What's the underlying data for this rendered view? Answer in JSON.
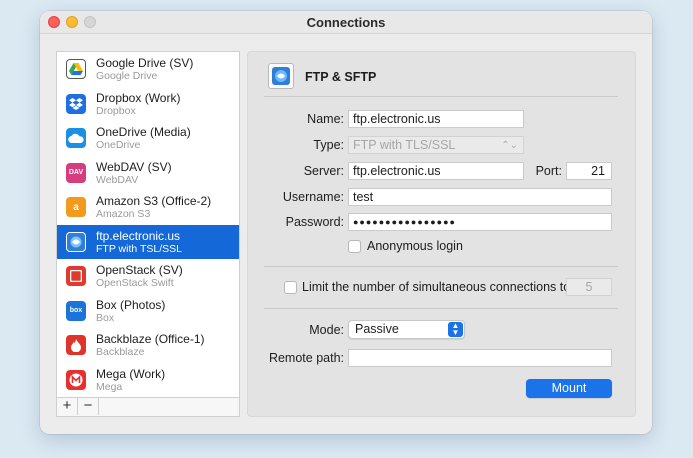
{
  "window": {
    "title": "Connections"
  },
  "sidebar": {
    "items": [
      {
        "name": "Google Drive (SV)",
        "sub": "Google Drive",
        "icon": "google-drive-icon",
        "color": "#ffffff"
      },
      {
        "name": "Dropbox (Work)",
        "sub": "Dropbox",
        "icon": "dropbox-icon",
        "color": "#1f6fe0"
      },
      {
        "name": "OneDrive (Media)",
        "sub": "OneDrive",
        "icon": "onedrive-icon",
        "color": "#1a8fe3"
      },
      {
        "name": "WebDAV (SV)",
        "sub": "WebDAV",
        "icon": "webdav-icon",
        "color": "#d63d7e",
        "glyph": "DAV"
      },
      {
        "name": "Amazon S3 (Office-2)",
        "sub": "Amazon S3",
        "icon": "amazon-s3-icon",
        "color": "#f29a1b",
        "glyph": "a"
      },
      {
        "name": "ftp.electronic.us",
        "sub": "FTP with TSL/SSL",
        "icon": "ftp-icon",
        "color": "#2f7fd6",
        "selected": true
      },
      {
        "name": "OpenStack (SV)",
        "sub": "OpenStack Swift",
        "icon": "openstack-icon",
        "color": "#e03a2f"
      },
      {
        "name": "Box (Photos)",
        "sub": "Box",
        "icon": "box-icon",
        "color": "#1b74d9",
        "glyph": "box"
      },
      {
        "name": "Backblaze (Office-1)",
        "sub": "Backblaze",
        "icon": "backblaze-icon",
        "color": "#e0342a"
      },
      {
        "name": "Mega (Work)",
        "sub": "Mega",
        "icon": "mega-icon",
        "color": "#e5302f"
      }
    ],
    "add_label": "+",
    "remove_label": "−"
  },
  "panel": {
    "header_title": "FTP & SFTP",
    "name_label": "Name:",
    "name_value": "ftp.electronic.us",
    "type_label": "Type:",
    "type_value": "FTP with TLS/SSL",
    "server_label": "Server:",
    "server_value": "ftp.electronic.us",
    "port_label": "Port:",
    "port_value": "21",
    "username_label": "Username:",
    "username_value": "test",
    "password_label": "Password:",
    "password_value": "●●●●●●●●●●●●●●●●",
    "anonymous_label": "Anonymous login",
    "limit_label": "Limit the number of simultaneous connections to",
    "limit_value": "5",
    "mode_label": "Mode:",
    "mode_value": "Passive",
    "remote_path_label": "Remote path:",
    "remote_path_value": "",
    "mount_label": "Mount"
  },
  "colors": {
    "accent": "#1a73e8",
    "selection": "#1568d8",
    "background": "#dbe9f3"
  }
}
